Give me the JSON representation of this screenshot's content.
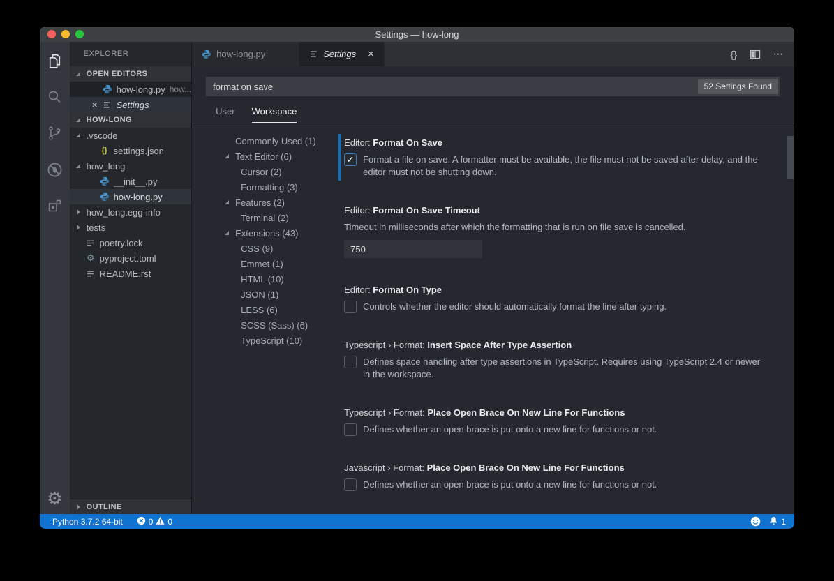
{
  "window": {
    "title": "Settings — how-long"
  },
  "activity_bar": {
    "top_items": [
      {
        "name": "explorer",
        "icon": "files-icon",
        "active": true
      },
      {
        "name": "search",
        "icon": "search-icon",
        "active": false
      },
      {
        "name": "source-control",
        "icon": "source-control-icon",
        "active": false
      },
      {
        "name": "debug",
        "icon": "debug-icon",
        "active": false
      },
      {
        "name": "extensions",
        "icon": "extensions-icon",
        "active": false
      }
    ],
    "bottom_items": [
      {
        "name": "manage",
        "icon": "gear-icon",
        "active": false
      }
    ]
  },
  "explorer": {
    "title": "EXPLORER",
    "open_editors": {
      "header": "OPEN EDITORS",
      "items": [
        {
          "label": "how-long.py",
          "detail": "how...",
          "icon": "python-icon",
          "italic": false,
          "close": false,
          "style": "dimbg"
        },
        {
          "label": "Settings",
          "detail": "",
          "icon": "settings-list-icon",
          "italic": true,
          "close": true,
          "style": "selhover"
        }
      ]
    },
    "project": {
      "name": "HOW-LONG",
      "files": [
        {
          "name": ".vscode",
          "twistie": "open",
          "icon": "",
          "level": 0,
          "selected": false
        },
        {
          "name": "settings.json",
          "twistie": "",
          "icon": "braces-icon",
          "level": 1,
          "selected": false
        },
        {
          "name": "how_long",
          "twistie": "open",
          "icon": "",
          "level": 0,
          "selected": false
        },
        {
          "name": "__init__.py",
          "twistie": "",
          "icon": "python-icon",
          "level": 1,
          "selected": false
        },
        {
          "name": "how-long.py",
          "twistie": "",
          "icon": "python-icon",
          "level": 1,
          "selected": true
        },
        {
          "name": "how_long.egg-info",
          "twistie": "closed",
          "icon": "",
          "level": 0,
          "selected": false
        },
        {
          "name": "tests",
          "twistie": "closed",
          "icon": "",
          "level": 0,
          "selected": false
        },
        {
          "name": "poetry.lock",
          "twistie": "",
          "icon": "list-icon",
          "level": 0,
          "selected": false
        },
        {
          "name": "pyproject.toml",
          "twistie": "",
          "icon": "gear-file-icon",
          "level": 0,
          "selected": false
        },
        {
          "name": "README.rst",
          "twistie": "",
          "icon": "list-icon",
          "level": 0,
          "selected": false
        }
      ]
    },
    "outline": {
      "label": "OUTLINE"
    }
  },
  "tabs": [
    {
      "label": "how-long.py",
      "icon": "python-icon",
      "active": false,
      "italic": false,
      "close": false
    },
    {
      "label": "Settings",
      "icon": "settings-list-icon",
      "active": true,
      "italic": true,
      "close": true
    }
  ],
  "editor_actions": [
    {
      "name": "open-settings-json",
      "glyph": "{}"
    },
    {
      "name": "split-editor",
      "icon": "split-editor-icon"
    },
    {
      "name": "more-actions",
      "glyph": "⋯"
    }
  ],
  "settings": {
    "search_value": "format on save",
    "results_badge": "52 Settings Found",
    "scope_tabs": [
      {
        "label": "User",
        "active": false
      },
      {
        "label": "Workspace",
        "active": true
      }
    ],
    "toc": [
      {
        "label": "Commonly Used",
        "count": "1",
        "level": 0,
        "twistie": ""
      },
      {
        "label": "Text Editor",
        "count": "6",
        "level": 0,
        "twistie": "open"
      },
      {
        "label": "Cursor",
        "count": "2",
        "level": 1,
        "twistie": ""
      },
      {
        "label": "Formatting",
        "count": "3",
        "level": 1,
        "twistie": ""
      },
      {
        "label": "Features",
        "count": "2",
        "level": 0,
        "twistie": "open"
      },
      {
        "label": "Terminal",
        "count": "2",
        "level": 1,
        "twistie": ""
      },
      {
        "label": "Extensions",
        "count": "43",
        "level": 0,
        "twistie": "open"
      },
      {
        "label": "CSS",
        "count": "9",
        "level": 1,
        "twistie": ""
      },
      {
        "label": "Emmet",
        "count": "1",
        "level": 1,
        "twistie": ""
      },
      {
        "label": "HTML",
        "count": "10",
        "level": 1,
        "twistie": ""
      },
      {
        "label": "JSON",
        "count": "1",
        "level": 1,
        "twistie": ""
      },
      {
        "label": "LESS",
        "count": "6",
        "level": 1,
        "twistie": ""
      },
      {
        "label": "SCSS (Sass)",
        "count": "6",
        "level": 1,
        "twistie": ""
      },
      {
        "label": "TypeScript",
        "count": "10",
        "level": 1,
        "twistie": ""
      }
    ],
    "entries": [
      {
        "category": "Editor:",
        "name": "Format On Save",
        "type": "checkbox",
        "checked": true,
        "modified": true,
        "description": "Format a file on save. A formatter must be available, the file must not be saved after delay, and the editor must not be shutting down."
      },
      {
        "category": "Editor:",
        "name": "Format On Save Timeout",
        "type": "number",
        "value": "750",
        "modified": false,
        "description": "Timeout in milliseconds after which the formatting that is run on file save is cancelled."
      },
      {
        "category": "Editor:",
        "name": "Format On Type",
        "type": "checkbox",
        "checked": false,
        "modified": false,
        "description": "Controls whether the editor should automatically format the line after typing."
      },
      {
        "category": "Typescript › Format:",
        "name": "Insert Space After Type Assertion",
        "type": "checkbox",
        "checked": false,
        "modified": false,
        "description": "Defines space handling after type assertions in TypeScript. Requires using TypeScript 2.4 or newer in the workspace."
      },
      {
        "category": "Typescript › Format:",
        "name": "Place Open Brace On New Line For Functions",
        "type": "checkbox",
        "checked": false,
        "modified": false,
        "description": "Defines whether an open brace is put onto a new line for functions or not."
      },
      {
        "category": "Javascript › Format:",
        "name": "Place Open Brace On New Line For Functions",
        "type": "checkbox",
        "checked": false,
        "modified": false,
        "description": "Defines whether an open brace is put onto a new line for functions or not."
      }
    ]
  },
  "status_bar": {
    "python_version": "Python 3.7.2 64-bit",
    "error_count": "0",
    "warning_count": "0",
    "notification_count": "1"
  },
  "colors": {
    "status_bar": "#1073cf",
    "modified_indicator": "#0e70c0",
    "python_blue": "#4796cf",
    "badge_bg": "#55585d"
  }
}
